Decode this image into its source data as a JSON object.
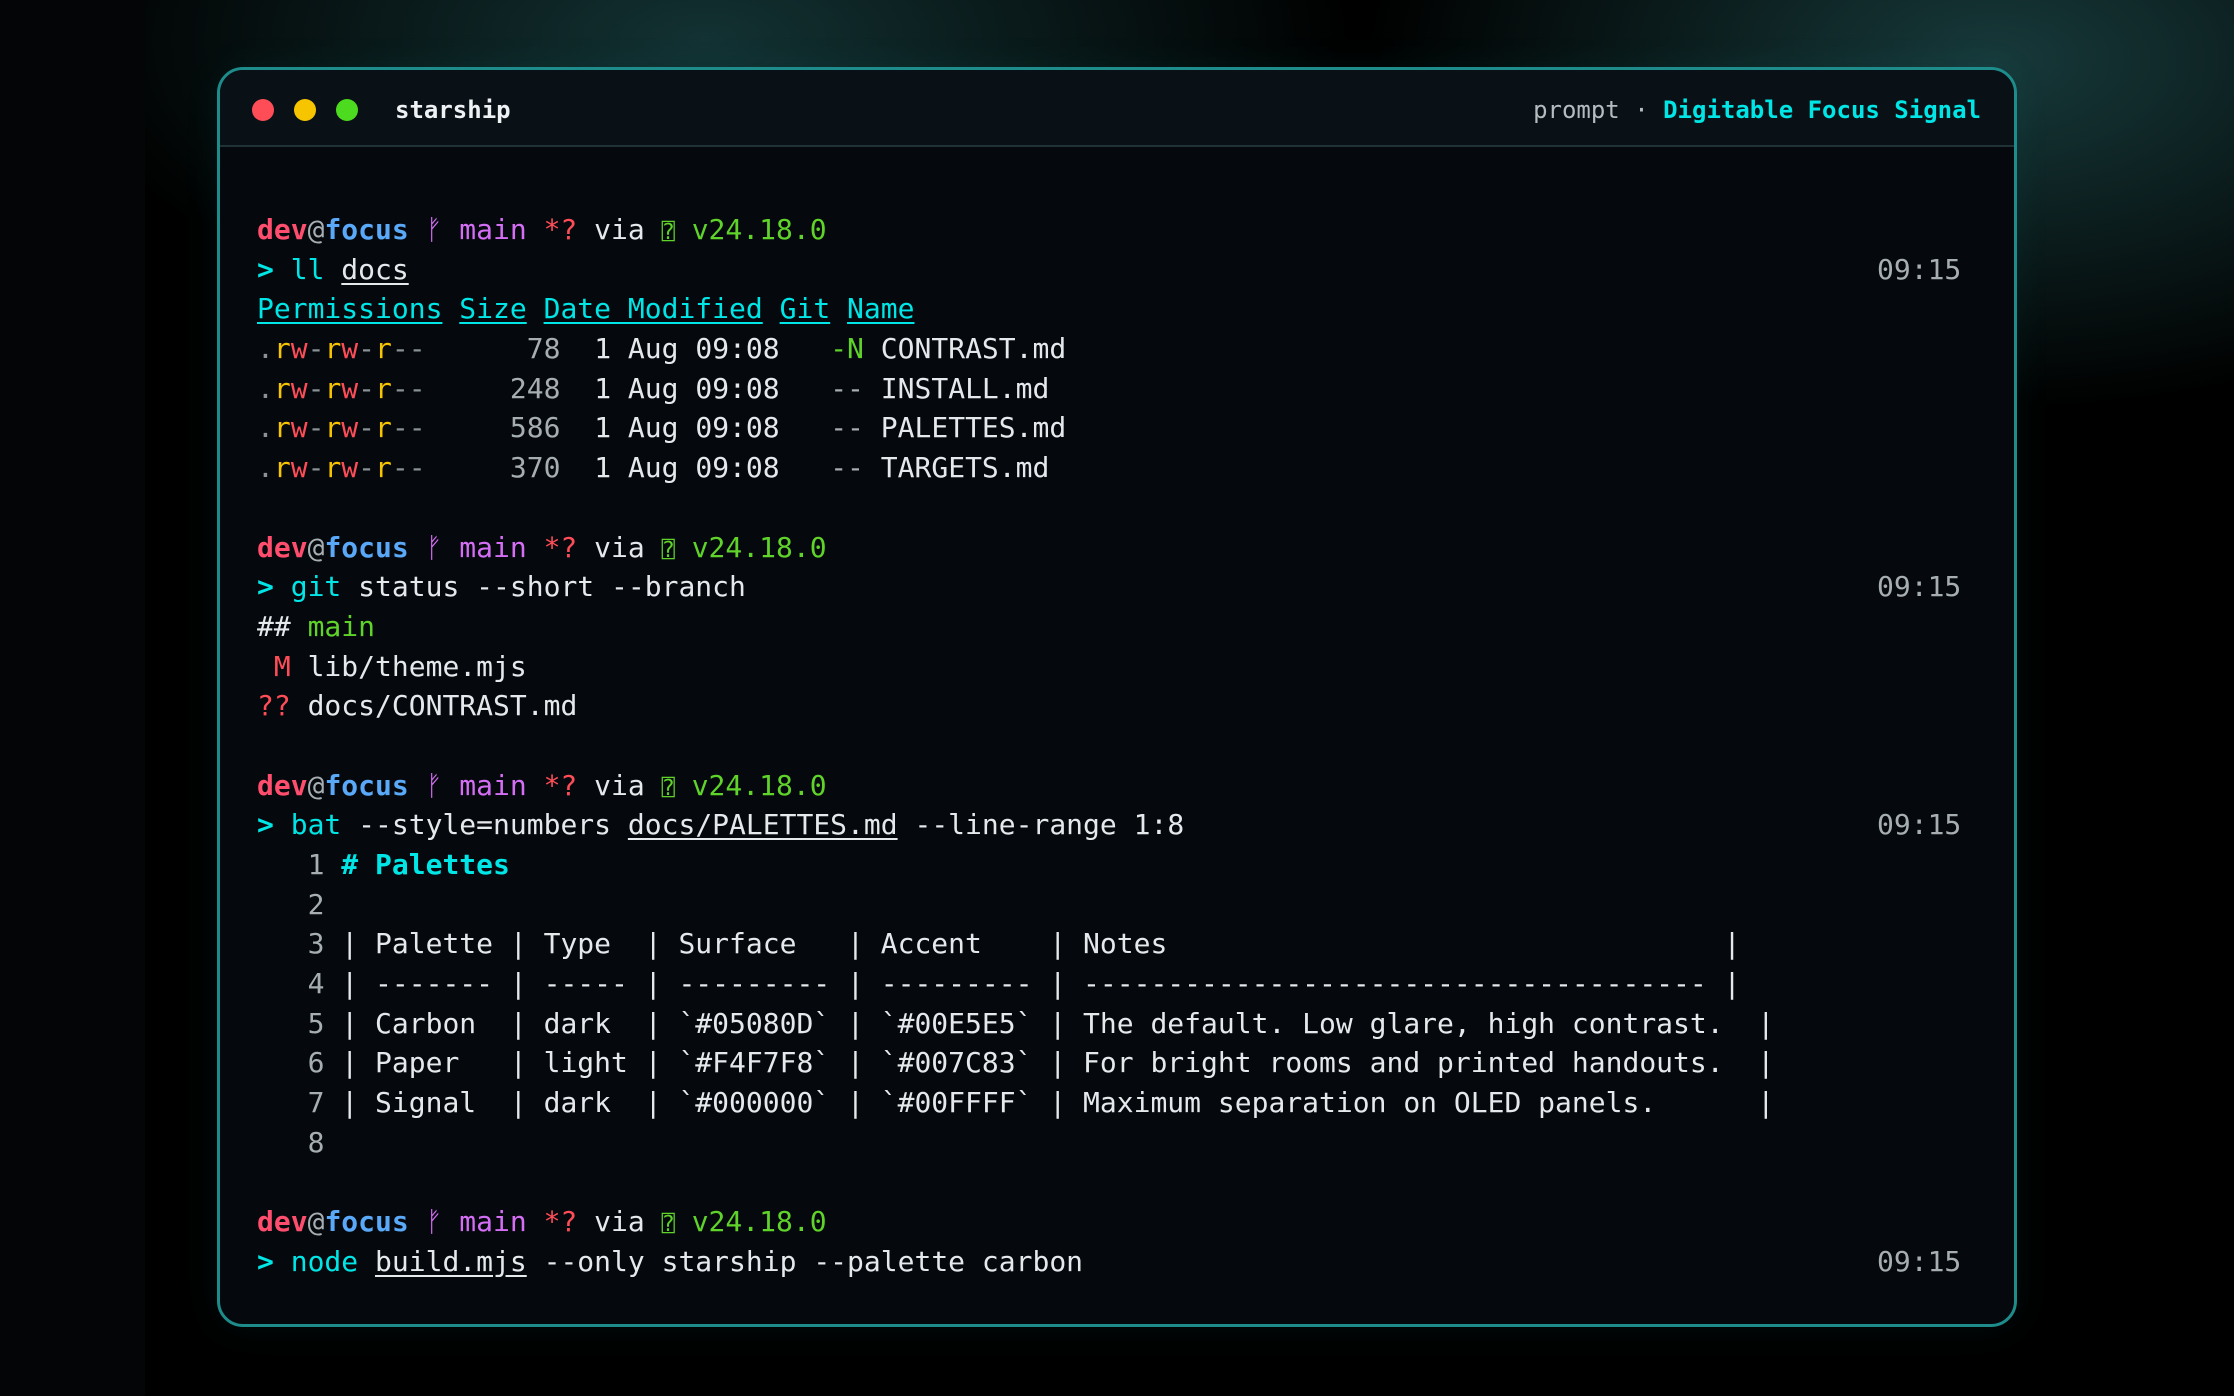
{
  "window": {
    "title": "starship",
    "right_prefix": "prompt · ",
    "theme_name": "Digitable Focus Signal"
  },
  "prompt": {
    "user": "dev",
    "at": "@",
    "host": "focus",
    "branch_icon": "ᚠ",
    "branch": "main",
    "status": "*?",
    "via": "via",
    "node_icon": "⍰",
    "node_version": "v24.18.0",
    "arrow": ">"
  },
  "blocks": [
    {
      "command": {
        "program": "ll",
        "args": [
          {
            "text": "docs",
            "underline": true
          }
        ]
      },
      "time": "09:15",
      "ls": {
        "headers": [
          "Permissions",
          "Size",
          "Date Modified",
          "Git",
          "Name"
        ],
        "rows": [
          {
            "perm": ".rw-rw-r--",
            "size": "78",
            "date": "1 Aug 09:08",
            "git": "-N",
            "name": "CONTRAST.md"
          },
          {
            "perm": ".rw-rw-r--",
            "size": "248",
            "date": "1 Aug 09:08",
            "git": "--",
            "name": "INSTALL.md"
          },
          {
            "perm": ".rw-rw-r--",
            "size": "586",
            "date": "1 Aug 09:08",
            "git": "--",
            "name": "PALETTES.md"
          },
          {
            "perm": ".rw-rw-r--",
            "size": "370",
            "date": "1 Aug 09:08",
            "git": "--",
            "name": "TARGETS.md"
          }
        ]
      }
    },
    {
      "command": {
        "program": "git",
        "args": [
          {
            "text": "status --short --branch",
            "underline": false
          }
        ]
      },
      "time": "09:15",
      "git_status": {
        "branch_prefix": "## ",
        "branch": "main",
        "entries": [
          {
            "code": " M",
            "path": "lib/theme.mjs"
          },
          {
            "code": "??",
            "path": "docs/CONTRAST.md"
          }
        ]
      }
    },
    {
      "command": {
        "program": "bat",
        "args": [
          {
            "text": "--style=numbers",
            "underline": false
          },
          {
            "text": "docs/PALETTES.md",
            "underline": true
          },
          {
            "text": "--line-range 1:8",
            "underline": false
          }
        ]
      },
      "time": "09:15",
      "bat_lines": [
        {
          "n": "1",
          "text": "# Palettes",
          "heading": true
        },
        {
          "n": "2",
          "text": ""
        },
        {
          "n": "3",
          "text": "| Palette | Type  | Surface   | Accent    | Notes                                 |"
        },
        {
          "n": "4",
          "text": "| ------- | ----- | --------- | --------- | ------------------------------------- |"
        },
        {
          "n": "5",
          "text": "| Carbon  | dark  | `#05080D` | `#00E5E5` | The default. Low glare, high contrast.  |"
        },
        {
          "n": "6",
          "text": "| Paper   | light | `#F4F7F8` | `#007C83` | For bright rooms and printed handouts.  |"
        },
        {
          "n": "7",
          "text": "| Signal  | dark  | `#000000` | `#00FFFF` | Maximum separation on OLED panels.      |"
        },
        {
          "n": "8",
          "text": ""
        }
      ]
    },
    {
      "command": {
        "program": "node",
        "args": [
          {
            "text": "build.mjs",
            "underline": true
          },
          {
            "text": "--only starship --palette carbon",
            "underline": false
          }
        ]
      },
      "time": "09:15"
    }
  ],
  "colors": {
    "surface": "#05080D",
    "accent": "#00E5E5",
    "user": "#FF4D6D",
    "host": "#5AA9F8",
    "branch": "#D46EF5",
    "node": "#5FD32A",
    "error": "#FF4D58",
    "warn": "#F7C400"
  }
}
